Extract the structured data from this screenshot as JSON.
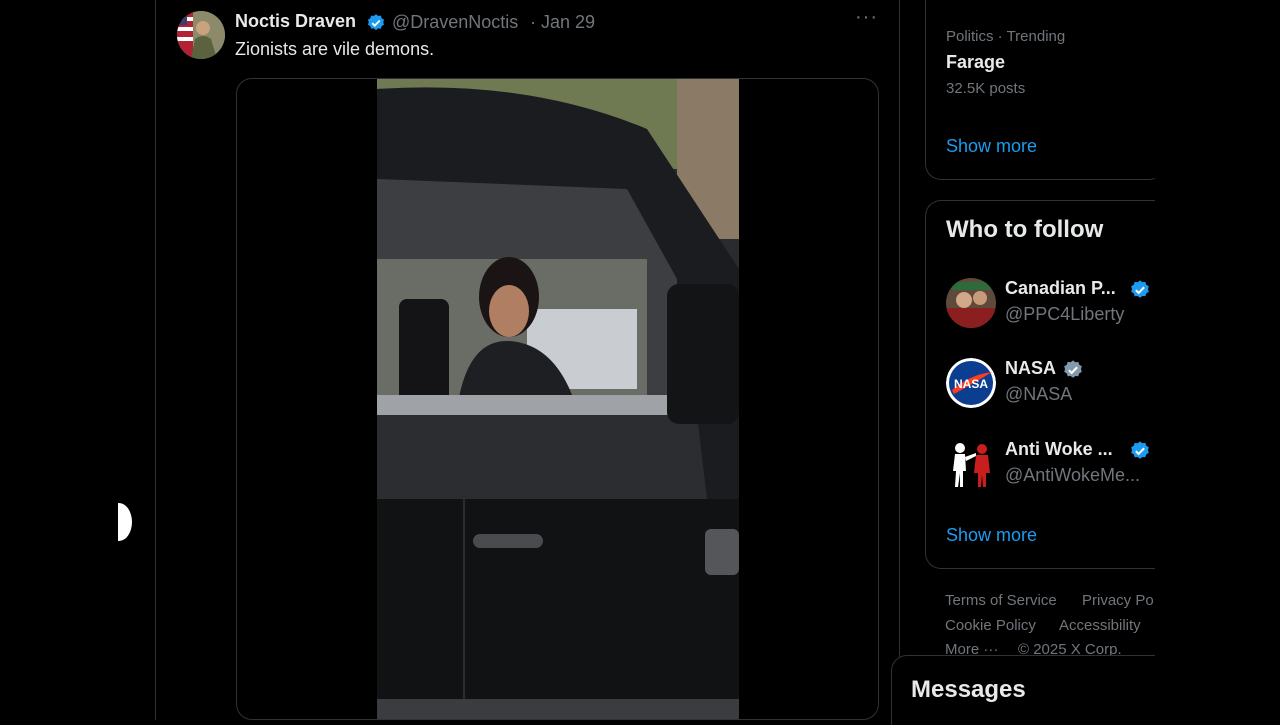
{
  "tweet": {
    "author_name": "Noctis Draven",
    "author_handle": "@DravenNoctis",
    "separator": "·",
    "date": "Jan 29",
    "more_glyph": "···",
    "text": "Zionists are vile demons."
  },
  "sidebar": {
    "trend": {
      "meta": "Politics · Trending",
      "name": "Farage",
      "count": "32.5K posts",
      "show_more": "Show more"
    },
    "who_to_follow": {
      "title": "Who to follow",
      "accounts": [
        {
          "name": "Canadian P...",
          "handle": "@PPC4Liberty"
        },
        {
          "name": "NASA",
          "handle": "@NASA"
        },
        {
          "name": "Anti Woke ...",
          "handle": "@AntiWokeMe..."
        }
      ],
      "show_more": "Show more"
    },
    "footer": {
      "terms": "Terms of Service",
      "privacy": "Privacy Po",
      "cookie": "Cookie Policy",
      "accessibility": "Accessibility",
      "more": "More ···",
      "copyright": "© 2025 X Corp."
    }
  },
  "messages": {
    "title": "Messages"
  },
  "colors": {
    "background": "#000000",
    "text_primary": "#e7e9ea",
    "text_secondary": "#71767b",
    "accent": "#1d9bf0",
    "border": "#2f3336",
    "verified_blue": "#1d9bf0",
    "verified_gray": "#829aab"
  }
}
